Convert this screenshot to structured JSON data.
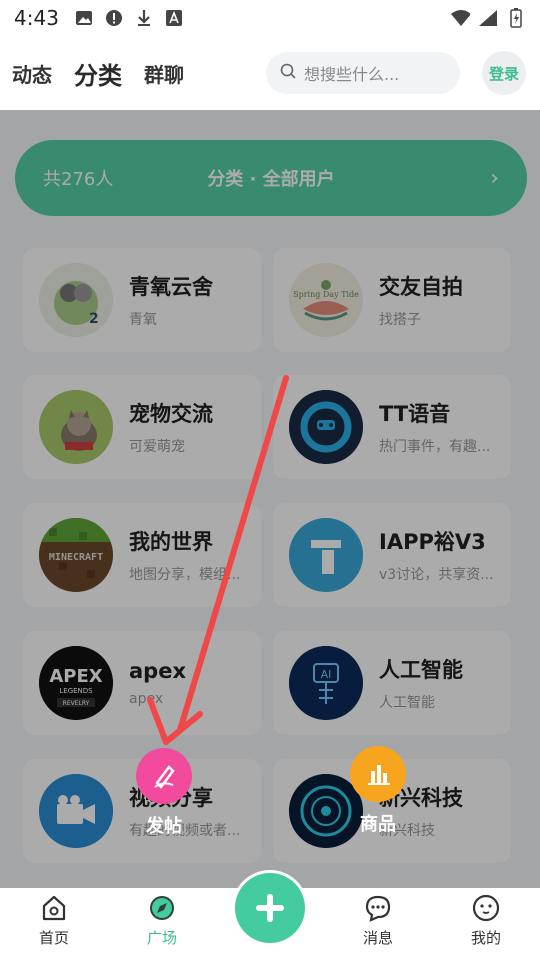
{
  "status_bar": {
    "time": "4:43"
  },
  "top_nav": {
    "tabs": [
      {
        "label": "动态"
      },
      {
        "label": "分类"
      },
      {
        "label": "群聊"
      }
    ],
    "active_tab": "分类",
    "search_placeholder": "想搜些什么...",
    "login_label": "登录"
  },
  "banner": {
    "count_text": "共276人",
    "title": "分类 · 全部用户",
    "arrow": "›"
  },
  "categories": [
    {
      "name": "青氧云舍",
      "desc": "青氧"
    },
    {
      "name": "交友自拍",
      "desc": "找搭子"
    },
    {
      "name": "宠物交流",
      "desc": "可爱萌宠"
    },
    {
      "name": "TT语音",
      "desc": "热门事件，有趣..."
    },
    {
      "name": "我的世界",
      "desc": "地图分享，模组..."
    },
    {
      "name": "IAPP裕V3",
      "desc": "v3讨论，共享资..."
    },
    {
      "name": "apex",
      "desc": "apex"
    },
    {
      "name": "人工智能",
      "desc": "人工智能"
    },
    {
      "name": "视频分享",
      "desc": "有趣的视频或者..."
    },
    {
      "name": "新兴科技",
      "desc": "新兴科技"
    }
  ],
  "avatar_texts": {
    "minecraft": "MINECRAFT",
    "apex_logo": "APEX",
    "apex_sub": "LEGENDS",
    "apex_tag": "REVELRY",
    "ai": "AI",
    "spring": "Spring Day Tide"
  },
  "fab_menu": {
    "post_label": "发帖",
    "goods_label": "商品",
    "post_color": "#f24a9c",
    "goods_color": "#f7a51f"
  },
  "bottom_nav": {
    "items": [
      {
        "label": "首页"
      },
      {
        "label": "广场"
      },
      {
        "label": ""
      },
      {
        "label": "消息"
      },
      {
        "label": "我的"
      }
    ],
    "active": "广场"
  },
  "colors": {
    "accent": "#45cba0",
    "annotation_arrow": "#f04848"
  }
}
